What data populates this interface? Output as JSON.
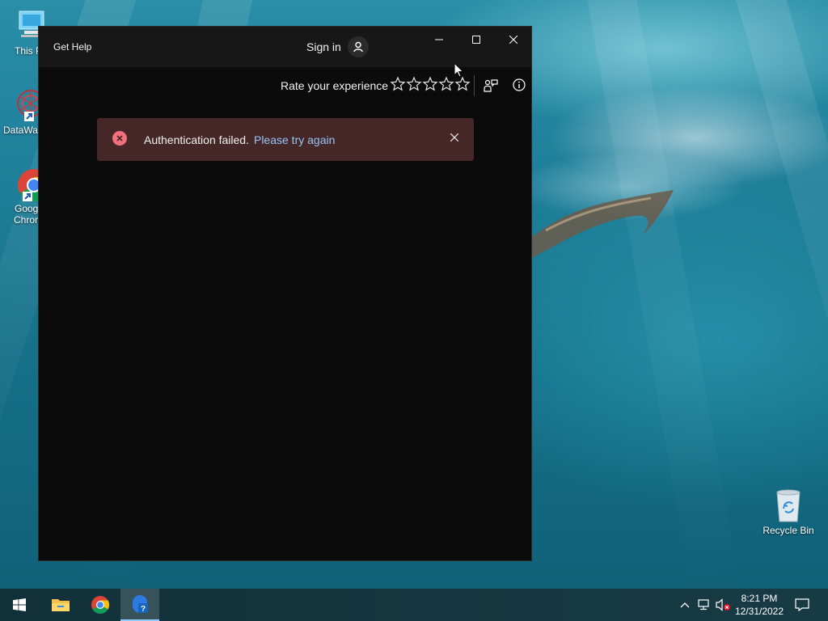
{
  "desktop": {
    "icons": [
      {
        "label": "This PC"
      },
      {
        "label": "DataWag"
      },
      {
        "label": "Google Chrome",
        "label_line1": "Goog",
        "label_line2": "Chron"
      },
      {
        "label": "Recycle Bin"
      }
    ]
  },
  "app": {
    "title": "Get Help",
    "sign_in_label": "Sign in",
    "rate_label": "Rate your experience",
    "stars": [
      {
        "icon": "star-outline-icon"
      },
      {
        "icon": "star-outline-icon"
      },
      {
        "icon": "star-outline-icon"
      },
      {
        "icon": "star-outline-icon"
      },
      {
        "icon": "star-outline-icon"
      }
    ],
    "error": {
      "message": "Authentication failed.",
      "link": "Please try again",
      "color": "#442726",
      "icon_color": "#f1707b",
      "link_color": "#99c4f5"
    }
  },
  "taskbar": {
    "time": "8:21 PM",
    "date": "12/31/2022",
    "items": [
      "start-icon",
      "file-explorer-icon",
      "chrome-icon",
      "get-help-icon"
    ]
  }
}
